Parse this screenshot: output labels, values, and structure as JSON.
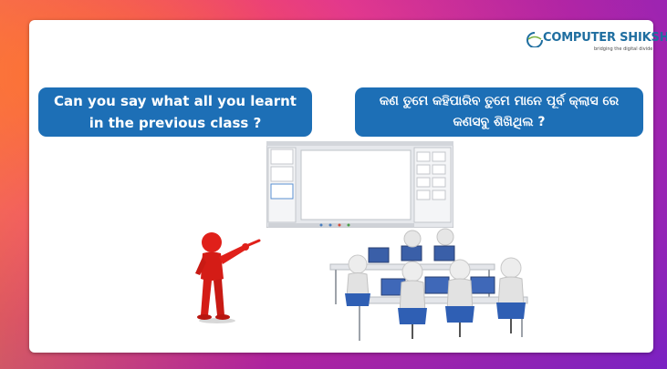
{
  "logo": {
    "main": "COMPUTER SHIKSHA",
    "tagline": "bridging the digital divide",
    "icon": "globe-icon",
    "color": "#1f6ea0"
  },
  "bubbles": {
    "english": "Can you say what all you learnt in the previous class ?",
    "odia": "କଣ ତୁମେ କହିପାରିବ ତୁମେ ମାନେ ପୂର୍ବ କ୍ଲାସ ରେ କଣସବୁ ଶିଖିଥିଲ ?",
    "color": "#1d6fb6"
  },
  "illustrations": {
    "pointer_figure": "red-figure-pointing",
    "screenshot": "presentation-app-screenshot",
    "classroom": "computer-lab-figures"
  }
}
